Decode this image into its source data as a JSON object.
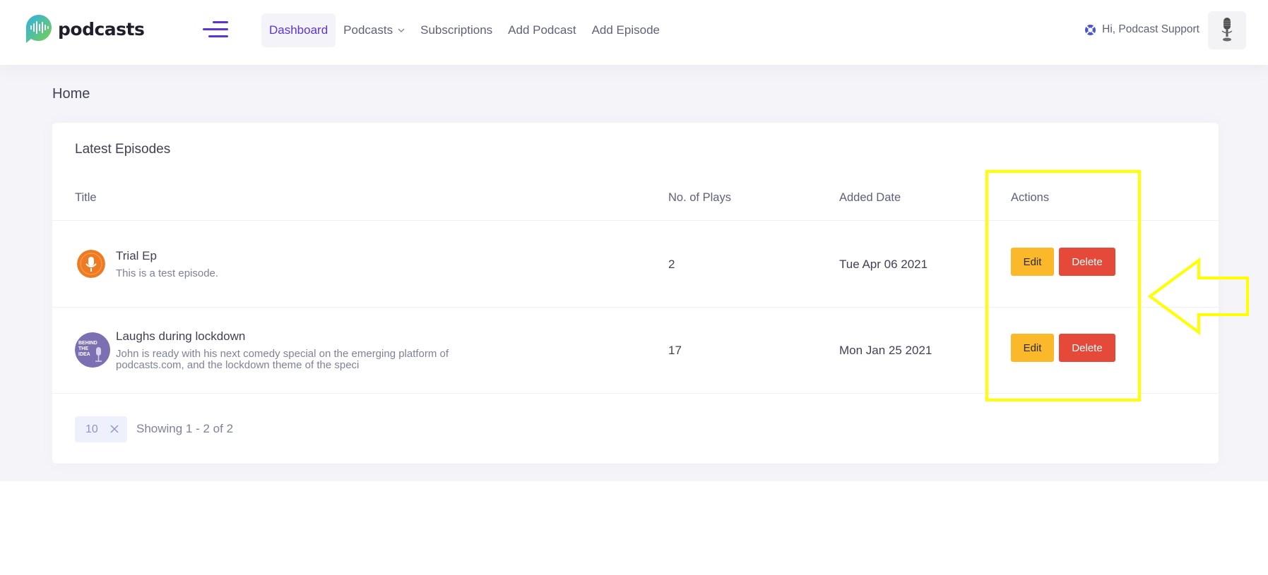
{
  "brand": {
    "name": "podcasts"
  },
  "nav": {
    "items": [
      {
        "label": "Dashboard",
        "active": true
      },
      {
        "label": "Podcasts",
        "dropdown": true
      },
      {
        "label": "Subscriptions"
      },
      {
        "label": "Add Podcast"
      },
      {
        "label": "Add Episode"
      }
    ]
  },
  "user": {
    "greeting": "Hi, Podcast Support"
  },
  "page": {
    "title": "Home"
  },
  "card": {
    "title": "Latest Episodes",
    "columns": [
      "Title",
      "No. of Plays",
      "Added Date",
      "Actions"
    ],
    "rows": [
      {
        "title": "Trial Ep",
        "description": "This is a test episode.",
        "plays": "2",
        "date": "Tue Apr 06 2021",
        "thumb": "mic-orange-icon"
      },
      {
        "title": "Laughs during lockdown",
        "description": "John is ready with his next comedy special on the emerging platform of podcasts.com, and the lockdown theme of the speci",
        "plays": "17",
        "date": "Mon Jan 25 2021",
        "thumb": "behind-the-idea-cover",
        "thumb_text": "BEHIND THE IDEA"
      }
    ],
    "actions": {
      "edit": "Edit",
      "delete": "Delete"
    }
  },
  "pagination": {
    "page_size": "10",
    "info": "Showing 1 - 2 of 2"
  },
  "colors": {
    "accent": "#5b34d9",
    "edit": "#fbb82a",
    "delete": "#e5493a",
    "highlight": "#ffff00"
  }
}
